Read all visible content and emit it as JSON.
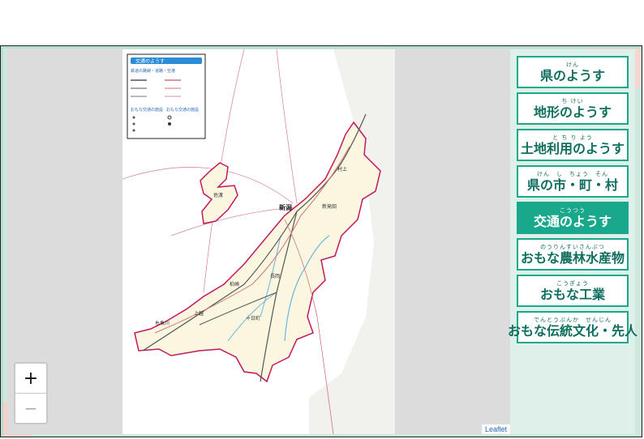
{
  "map": {
    "labels": {
      "niigata": "新潟",
      "murakami": "村上",
      "shibata": "新発田",
      "sado": "佐渡",
      "nagaoka": "長岡",
      "kashiwazaki": "柏崎",
      "joetsu": "上越",
      "tokamachi": "十日町",
      "itoigawa": "糸魚川"
    },
    "legend": {
      "header": "交通のようす",
      "subtitle": "鉄道の路線・道路・空港",
      "section1": "おもな交通の施設",
      "section2": "おもな交通の施設"
    }
  },
  "zoom": {
    "in": "+",
    "out": "−"
  },
  "attribution": "Leaflet",
  "menu": [
    {
      "ruby": "けん",
      "label": "県のようす",
      "active": false
    },
    {
      "ruby": "ち けい",
      "label": "地形のようす",
      "active": false
    },
    {
      "ruby": "と ち り よう",
      "label": "土地利用のようす",
      "active": false
    },
    {
      "ruby": "けん　し　ちょう　そん",
      "label": "県の市・町・村",
      "active": false
    },
    {
      "ruby": "こうつう",
      "label": "交通のようす",
      "active": true
    },
    {
      "ruby": "のうりんすいさんぶつ",
      "label": "おもな農林水産物",
      "active": false
    },
    {
      "ruby": "こうぎょう",
      "label": "おもな工業",
      "active": false
    },
    {
      "ruby": "でんとうぶんか　せんじん",
      "label": "おもな伝統文化・先人",
      "active": false
    }
  ],
  "colors": {
    "accent": "#1aa88c",
    "border": "#c2185b",
    "land": "#fbf6e0"
  }
}
